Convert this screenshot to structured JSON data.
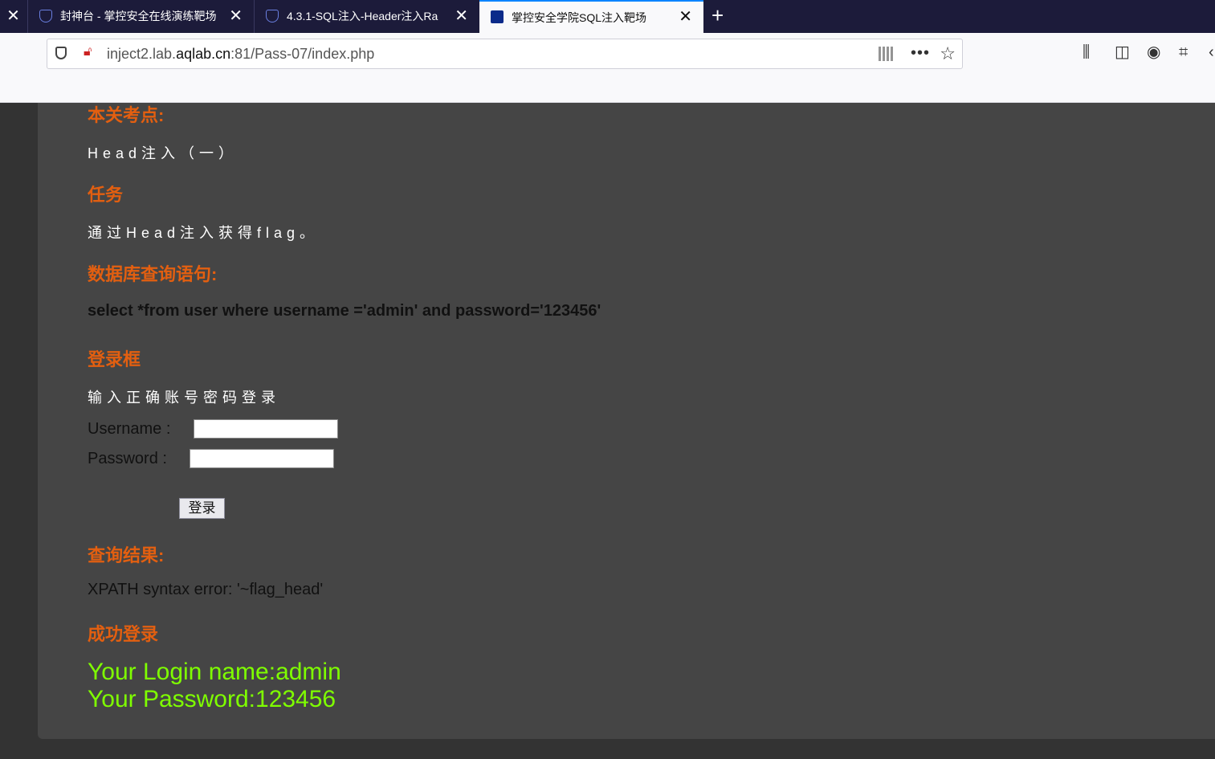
{
  "tabs": [
    {
      "title": "封神台 - 掌控安全在线演练靶场",
      "close": "✕"
    },
    {
      "title": "4.3.1-SQL注入-Header注入Ra",
      "close": "✕"
    },
    {
      "title": "掌控安全学院SQL注入靶场",
      "close": "✕"
    }
  ],
  "left_close": "✕",
  "new_tab": "+",
  "url": {
    "prefix": "inject2.lab.",
    "domain": "aqlab.cn",
    "suffix": ":81/Pass-07/index.php"
  },
  "page": {
    "h_points": "本关考点:",
    "points": "Head注入（一）",
    "h_task": "任务",
    "task": "通过Head注入获得flag。",
    "h_sql": "数据库查询语句:",
    "sql": "select *from user where username ='admin' and password='123456'",
    "h_login": "登录框",
    "login_hint": "输入正确账号密码登录",
    "username_label": "Username :",
    "password_label": "Password :",
    "username_value": "",
    "password_value": "",
    "login_button": "登录",
    "h_result": "查询结果:",
    "result": "XPATH syntax error: '~flag_head'",
    "h_success": "成功登录",
    "login_name": "Your Login name:admin",
    "login_password": "Your Password:123456"
  }
}
